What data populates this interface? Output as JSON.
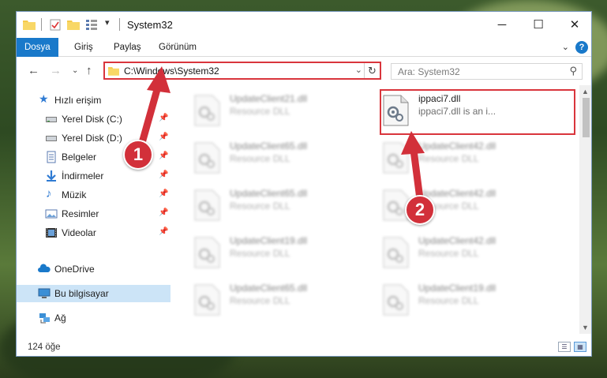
{
  "window": {
    "title": "System32",
    "minimize": "─",
    "maximize": "☐",
    "close": "✕"
  },
  "ribbon": {
    "tabs": [
      {
        "label": "Dosya"
      },
      {
        "label": "Giriş"
      },
      {
        "label": "Paylaş"
      },
      {
        "label": "Görünüm"
      }
    ],
    "help": "?",
    "collapse": "⌄"
  },
  "address": {
    "path": "C:\\Windows\\System32",
    "search_placeholder": "Ara: System32"
  },
  "nav": {
    "quick_access": "Hızlı erişim",
    "items": [
      {
        "label": "Yerel Disk (C:)",
        "icon": "drive-icon"
      },
      {
        "label": "Yerel Disk (D:)",
        "icon": "drive-icon"
      },
      {
        "label": "Belgeler",
        "icon": "documents-icon"
      },
      {
        "label": "İndirmeler",
        "icon": "downloads-icon"
      },
      {
        "label": "Müzik",
        "icon": "music-icon"
      },
      {
        "label": "Resimler",
        "icon": "pictures-icon"
      },
      {
        "label": "Videolar",
        "icon": "videos-icon"
      }
    ],
    "onedrive": "OneDrive",
    "this_pc": "Bu bilgisayar",
    "network": "Ağ"
  },
  "files": [
    {
      "name": "UpdateClient21.dll",
      "desc": "Resource DLL"
    },
    {
      "name": "ippaci7.dll",
      "desc": "ippaci7.dll is an i..."
    },
    {
      "name": "UpdateClient65.dll",
      "desc": "Resource DLL"
    },
    {
      "name": "UpdateClient42.dll",
      "desc": "Resource DLL"
    },
    {
      "name": "UpdateClient65.dll",
      "desc": "Resource DLL"
    },
    {
      "name": "UpdateClient42.dll",
      "desc": "Resource DLL"
    },
    {
      "name": "UpdateClient19.dll",
      "desc": "Resource DLL"
    },
    {
      "name": "UpdateClient42.dll",
      "desc": "Resource DLL"
    },
    {
      "name": "UpdateClient65.dll",
      "desc": "Resource DLL"
    },
    {
      "name": "UpdateClient19.dll",
      "desc": "Resource DLL"
    }
  ],
  "status": {
    "item_count": "124 öğe"
  },
  "callouts": [
    "1",
    "2"
  ],
  "colors": {
    "accent": "#1979ca",
    "highlight_red": "#d9353c",
    "selection": "#cce4f7"
  }
}
